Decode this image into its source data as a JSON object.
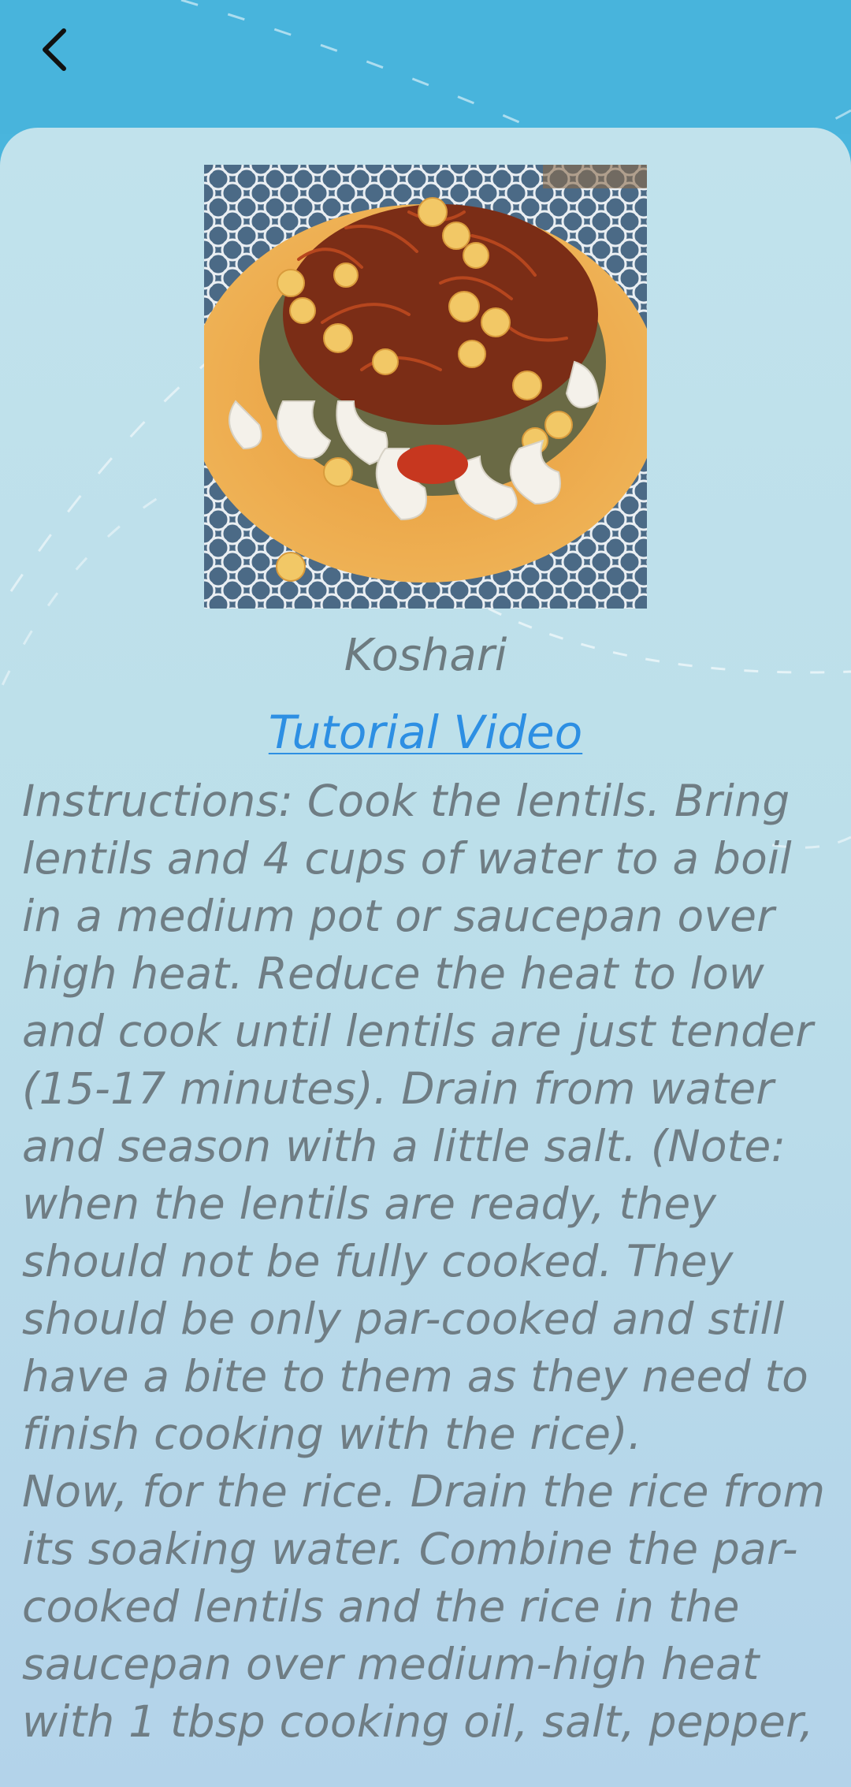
{
  "app": {
    "back_icon": "chevron-left-icon"
  },
  "recipe": {
    "title": "Koshari",
    "tutorial_link_label": "Tutorial Video",
    "image_alt": "Koshari dish photo",
    "instructions_part1": "Instructions: Cook the lentils. Bring lentils and 4 cups of water to a boil in a medium pot or saucepan over high heat. Reduce the heat to low and cook until lentils are just tender (15-17 minutes). Drain from water and season with a little salt. (Note: when the lentils are ready, they should not be fully cooked. They should be only par-cooked and still have a bite to them as they need to finish cooking with the rice).",
    "instructions_part2": "Now, for the rice. Drain the rice from its soaking water. Combine the par-cooked lentils and the rice in the saucepan over medium-high heat with 1 tbsp cooking oil, salt, pepper,"
  },
  "colors": {
    "header_blue": "#48b4dc",
    "card_bg": "#bcdfea",
    "link_blue": "#2d8fe3",
    "text_gray": "#6f7d84"
  }
}
